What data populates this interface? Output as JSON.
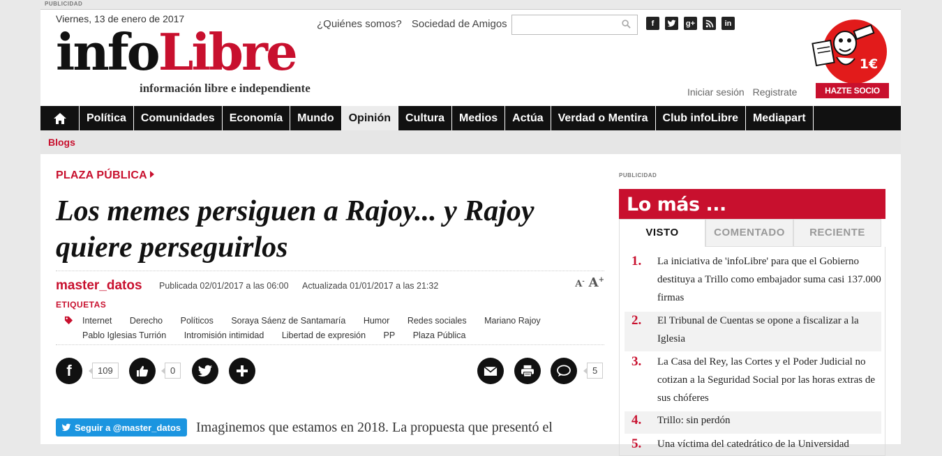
{
  "ad_top": "PUBLICIDAD",
  "header": {
    "date": "Viernes, 13 de enero de 2017",
    "logo_info": "info",
    "logo_libre": "Libre",
    "logo_tagline": "información libre e independiente",
    "links": [
      "¿Quiénes somos?",
      "Sociedad de Amigos"
    ],
    "search_placeholder": "",
    "social": [
      "facebook-icon",
      "twitter-icon",
      "googleplus-icon",
      "rss-icon",
      "linkedin-icon"
    ],
    "login": "Iniciar sesión",
    "register": "Registrate",
    "hazte_socio": "HAZTE SOCIO",
    "mascot_price": "1€",
    "brand_color": "#c8102e"
  },
  "nav": {
    "items": [
      "Política",
      "Comunidades",
      "Economía",
      "Mundo",
      "Opinión",
      "Cultura",
      "Medios",
      "Actúa",
      "Verdad o Mentira",
      "Club infoLibre",
      "Mediapart"
    ],
    "active": "Opinión",
    "sub": "Blogs"
  },
  "article": {
    "section": "PLAZA PÚBLICA",
    "title": "Los memes persiguen a Rajoy... y Rajoy quiere perseguirlos",
    "author": "master_datos",
    "published": "Publicada 02/01/2017 a las 06:00",
    "updated": "Actualizada 01/01/2017 a las 21:32",
    "font_small": "A",
    "font_big": "A",
    "tags_title": "ETIQUETAS",
    "tags": [
      "Internet",
      "Derecho",
      "Políticos",
      "Soraya Sáenz de Santamaría",
      "Humor",
      "Redes sociales",
      "Mariano Rajoy",
      "Pablo Iglesias Turrión",
      "Intromisión intimidad",
      "Libertad de expresión",
      "PP",
      "Plaza Pública"
    ],
    "share": {
      "facebook_count": "109",
      "like_count": "0",
      "comments_count": "5"
    },
    "follow_button": "Seguir a @master_datos",
    "body_start": "Imaginemos que estamos en 2018. La propuesta que presentó el"
  },
  "sidebar": {
    "ad_label": "PUBLICIDAD",
    "title": "Lo más ...",
    "tabs": [
      "VISTO",
      "COMENTADO",
      "RECIENTE"
    ],
    "active_tab": "VISTO",
    "ranking": [
      {
        "num": "1.",
        "text": "La iniciativa de 'infoLibre' para que el Gobierno destituya a Trillo como embajador suma casi 137.000 firmas"
      },
      {
        "num": "2.",
        "text": "El Tribunal de Cuentas se opone a fiscalizar a la Iglesia"
      },
      {
        "num": "3.",
        "text": "La Casa del Rey, las Cortes y el Poder Judicial no cotizan a la Seguridad Social por las horas extras de sus chóferes"
      },
      {
        "num": "4.",
        "text": "Trillo: sin perdón"
      },
      {
        "num": "5.",
        "text": "Una víctima del catedrático de la Universidad"
      }
    ]
  }
}
